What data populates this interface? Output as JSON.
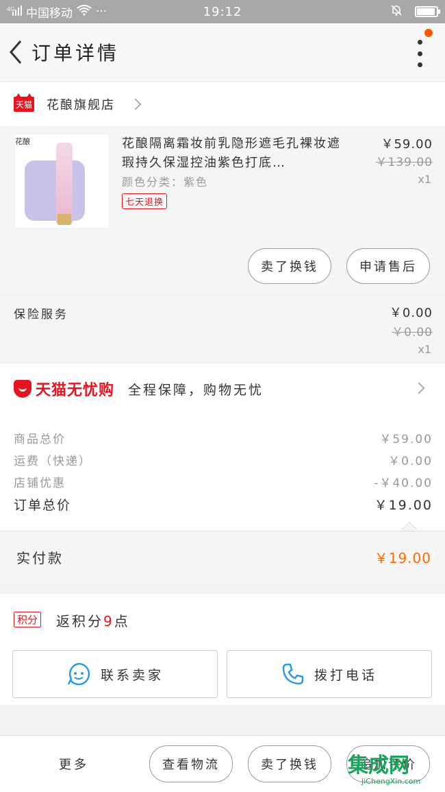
{
  "status_bar": {
    "signal_text": "⁴ᴳ",
    "carrier": "中国移动",
    "wifi_icon": "wifi-icon",
    "ellipsis": "···",
    "time": "19:12",
    "battery_level": 0.85
  },
  "nav": {
    "title": "订单详情",
    "has_notification_dot": true,
    "accent": "#ff5a00"
  },
  "store": {
    "badge": "天猫",
    "name": "花酿旗舰店"
  },
  "product": {
    "image_logo_text": "花酿",
    "title": "花酿隔离霜妆前乳隐形遮毛孔裸妆遮瑕持久保湿控油紫色打底…",
    "variant": "颜色分类：紫色",
    "tag": "七天退换",
    "price": "￥59.00",
    "original_price": "￥139.00",
    "quantity": "x1",
    "buttons": {
      "refund": "卖了换钱",
      "after_sales": "申请售后"
    }
  },
  "insurance": {
    "label": "保险服务",
    "price": "￥0.00",
    "original_price": "￥0.00",
    "quantity": "x1"
  },
  "worry_free": {
    "brand": "天猫无忧购",
    "description": "全程保障，购物无忧"
  },
  "summary": {
    "rows": [
      {
        "label": "商品总价",
        "value": "￥59.00"
      },
      {
        "label": "运费（快递）",
        "value": "￥0.00"
      },
      {
        "label": "店铺优惠",
        "value": "-￥40.00"
      }
    ],
    "total": {
      "label": "订单总价",
      "value": "￥19.00"
    }
  },
  "paid": {
    "label": "实付款",
    "value": "￥19.00",
    "color": "#ff6a00"
  },
  "points": {
    "badge": "积分",
    "prefix": "返积分",
    "amount": "9",
    "suffix": "点"
  },
  "contact": {
    "seller": "联系卖家",
    "call": "拨打电话"
  },
  "bottom_bar": {
    "more": "更多",
    "logistics": "查看物流",
    "resell": "卖了换钱",
    "review": "追加评价"
  },
  "watermark": {
    "main": "集成网",
    "sub": "JiChengXin.com"
  },
  "colors": {
    "tmall_red": "#e4151f",
    "paid_orange": "#ff6a00",
    "page_bg": "#f2f2f2"
  }
}
